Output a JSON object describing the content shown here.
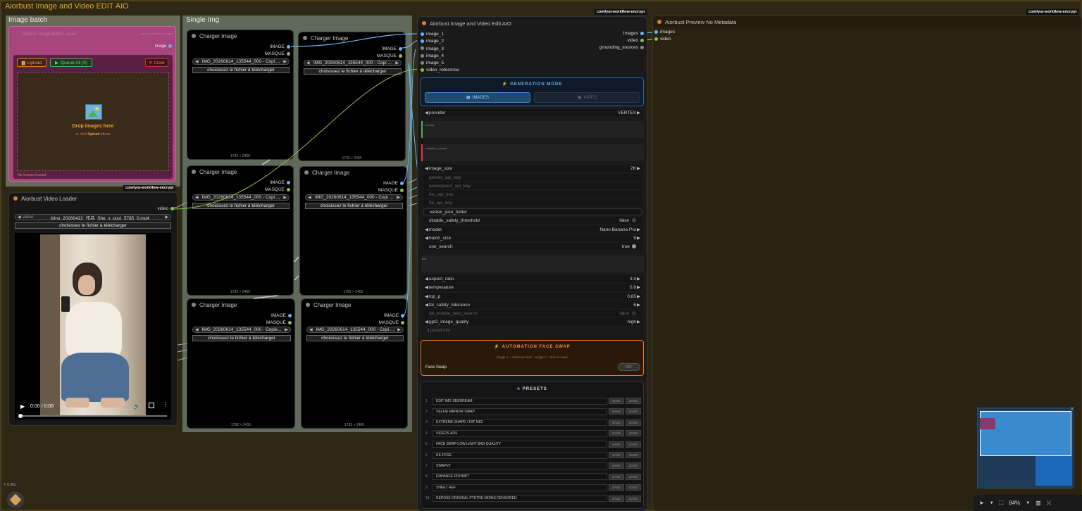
{
  "main_group": {
    "title": "Aiorbust Image and Video EDIT AIO"
  },
  "image_batch": {
    "title": "Image batch",
    "dim_node_title": "Aiorbust Image Batch Loader",
    "dim_badge": "comfyui-workflow-encrypt",
    "output": "image",
    "upload_btn": "Upload",
    "queue_btn": "Queue All (0)",
    "clear_btn": "Clear",
    "drop_title": "Drop images here",
    "drop_sub_pre": "or click ",
    "drop_sub_link": "Upload",
    "drop_sub_post": " above",
    "status": "No images loaded",
    "badge": "comfyui-workflow-encrypt"
  },
  "video_loader": {
    "title": "Aiorbust Video Loader",
    "output": "video",
    "video_label": "video",
    "video_value": "kling_20260422_作品_She_s_posi_5785_0.mp4",
    "choose_btn": "choisissez le fichier à télécharger",
    "time": "0:00 / 0:06",
    "progress": 0
  },
  "single_img": {
    "title": "Single Img",
    "nodes": [
      {
        "title": "Charger Image",
        "out1": "IMAGE",
        "out2": "MASQUE",
        "file": "IMG_20260614_135544_000 - Copi ...",
        "choose": "choisissez le fichier à télécharger",
        "dims": "1792 × 2400"
      },
      {
        "title": "Charger Image",
        "out1": "IMAGE",
        "out2": "MASQUE",
        "file": "IMG_20260614_135544_000 - Copi ...",
        "choose": "choisissez le fichier à télécharger",
        "dims": "1792 × 2400"
      },
      {
        "title": "Charger Image",
        "out1": "IMAGE",
        "out2": "MASQUE",
        "file": "IMG_20260614_135544_000 - Copi ...",
        "choose": "choisissez le fichier à télécharger",
        "dims": "1792 × 2400"
      },
      {
        "title": "Charger Image",
        "out1": "IMAGE",
        "out2": "MASQUE",
        "file": "IMG_20260614_135544_000 - Copi ...",
        "choose": "choisissez le fichier à télécharger",
        "dims": "1792 × 2400"
      },
      {
        "title": "Charger Image",
        "out1": "IMAGE",
        "out2": "MASQUE",
        "file": "IMG_20260614_135544_000 - Copie...",
        "choose": "choisissez le fichier à télécharger",
        "dims": "1792 × 2400"
      },
      {
        "title": "Charger Image",
        "out1": "IMAGE",
        "out2": "MASQUE",
        "file": "IMG_20260614_135544_000 - Copi ...",
        "choose": "choisissez le fichier à télécharger",
        "dims": "1792 × 2400"
      }
    ]
  },
  "aio": {
    "title": "Aiorbust Image and Video Edit AIO",
    "badge": "comfyui-workflow-encrypt",
    "inputs": [
      "image_1",
      "image_2",
      "image_3",
      "image_4",
      "image_5",
      "video_reference"
    ],
    "outputs": [
      "Images",
      "video",
      "grounding_sources"
    ],
    "gen_mode_title": "GENERATION MODE",
    "tab_images": "IMAGES",
    "tab_video": "VIDÉO",
    "provider_label": "provider",
    "provider_value": "VERTEX",
    "prompt_label": "prompt",
    "neg_prompt_label": "negative_prompt",
    "image_size_label": "image_size",
    "image_size_value": "2K",
    "gemini_key": "gemini_api_key",
    "wavespeed_key": "wavespeed_api_key",
    "kie_key": "kie_api_key",
    "fal_key": "fal_api_key",
    "vertex_folder": "vertex_json_folder",
    "disable_safety_label": "disable_safety_threshold",
    "disable_safety_value": "false",
    "model_label": "model",
    "model_value": "Nano Banana Pro",
    "batch_size_label": "batch_size",
    "batch_size_value": "5",
    "use_search_label": "use_search",
    "use_search_value": "true",
    "ratio_text": "3:4",
    "aspect_label": "aspect_ratio",
    "aspect_value": "3:4",
    "temperature_label": "temperature",
    "temperature_value": "0.8",
    "top_p_label": "top_p",
    "top_p_value": "0.85",
    "fal_tol_label": "fal_safety_tolerance",
    "fal_tol_value": "6",
    "fal_web_label": "fal_enable_web_search",
    "fal_web_value": "false",
    "gpt_label": "gpt2_image_quality",
    "gpt_value": "high",
    "preset_info": "preset info",
    "face_swap_title": "AUTOMATION FACE SWAP",
    "face_swap_hint": "Image 1 = reference face · Image 2 = face to swap",
    "face_swap_label": "Face Swap",
    "face_swap_value": "OFF",
    "presets_title": "PRESETS",
    "save_label": "SAVE",
    "load_label": "LOAD",
    "presets": [
      {
        "n": "1",
        "name": "EDIT IMG SEEDREAM"
      },
      {
        "n": "2",
        "name": "SELFIE MIRROR SWAP"
      },
      {
        "n": "3",
        "name": "EXTREME SHAPE / FAT NB2"
      },
      {
        "n": "4",
        "name": "VIDEOS ADS"
      },
      {
        "n": "5",
        "name": "FACE SWAP LOW LIGHT BAD QUALITY"
      },
      {
        "n": "6",
        "name": "RE-POSE"
      },
      {
        "n": "7",
        "name": "SWAPV2"
      },
      {
        "n": "8",
        "name": "ENHANCE PROMPT"
      },
      {
        "n": "9",
        "name": "SHEET REF"
      },
      {
        "n": "10",
        "name": "REPOSE ORIGINAL PTETRE MOINS CENSORED"
      }
    ]
  },
  "preview": {
    "title": "Aiorbust Preview No Metadata",
    "badge": "comfyui-workflow-encrypt",
    "inputs": [
      "images",
      "video"
    ]
  },
  "toolbar": {
    "zoom": "84%"
  },
  "stats": {
    "line1": "T: 0.00s"
  },
  "colors": {
    "accent": "#e0a82e",
    "orange": "#e8782a",
    "blue_port": "#64b5f6",
    "green_port": "#8bc34a",
    "batch_pink": "#a8457f"
  }
}
